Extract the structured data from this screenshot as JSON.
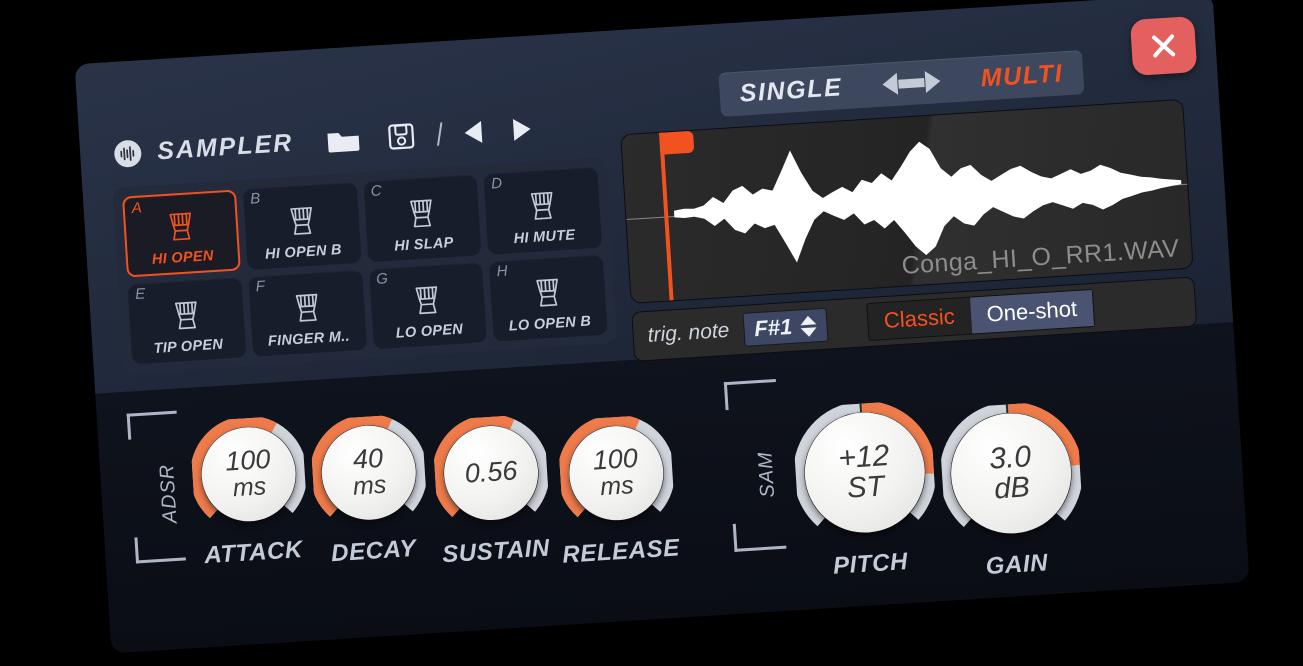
{
  "header": {
    "brand": "SAMPLER",
    "logo_icon": "waveform-circle-icon",
    "open_icon": "folder-icon",
    "save_icon": "floppy-disk-icon",
    "prev_icon": "prev-triangle-icon",
    "next_icon": "next-triangle-icon"
  },
  "mode_toggle": {
    "left_label": "SINGLE",
    "right_label": "MULTI",
    "active": "MULTI",
    "arrows_icon": "left-right-arrows-icon",
    "active_color": "#f2521f",
    "inactive_color": "#e3e7ef"
  },
  "close_button": {
    "icon": "close-x-icon",
    "color": "#e3605f"
  },
  "pads": [
    {
      "letter": "A",
      "label": "HI OPEN",
      "icon": "djembe-icon",
      "selected": true
    },
    {
      "letter": "B",
      "label": "HI OPEN B",
      "icon": "djembe-icon",
      "selected": false
    },
    {
      "letter": "C",
      "label": "HI SLAP",
      "icon": "djembe-icon",
      "selected": false
    },
    {
      "letter": "D",
      "label": "HI MUTE",
      "icon": "djembe-icon",
      "selected": false
    },
    {
      "letter": "E",
      "label": "TIP OPEN",
      "icon": "djembe-icon",
      "selected": false
    },
    {
      "letter": "F",
      "label": "FINGER M..",
      "icon": "djembe-icon",
      "selected": false
    },
    {
      "letter": "G",
      "label": "LO OPEN",
      "icon": "djembe-icon",
      "selected": false
    },
    {
      "letter": "H",
      "label": "LO OPEN B",
      "icon": "djembe-icon",
      "selected": false
    }
  ],
  "waveform": {
    "filename": "Conga_HI_O_RR1.WAV",
    "start_marker_color": "#f2521f",
    "wave_color": "#ffffff"
  },
  "trigger_bar": {
    "note_label": "trig. note",
    "note_value": "F#1",
    "stepper_icon": "up-down-arrows-icon",
    "mode_classic": "Classic",
    "mode_oneshot": "One-shot",
    "active_mode": "One-shot"
  },
  "groups": {
    "adsr_label": "ADSR",
    "sampler_label": "SAM"
  },
  "knobs": [
    {
      "name": "attack",
      "label": "ATTACK",
      "value": "100",
      "unit": "ms",
      "type": "unipolar",
      "amount": 0.62
    },
    {
      "name": "decay",
      "label": "DECAY",
      "value": "40",
      "unit": "ms",
      "type": "unipolar",
      "amount": 0.6
    },
    {
      "name": "sustain",
      "label": "SUSTAIN",
      "value": "0.56",
      "unit": "",
      "type": "unipolar",
      "amount": 0.6
    },
    {
      "name": "release",
      "label": "RELEASE",
      "value": "100",
      "unit": "ms",
      "type": "unipolar",
      "amount": 0.6
    },
    {
      "name": "pitch",
      "label": "PITCH",
      "value": "+12",
      "unit": "ST",
      "type": "bipolar",
      "amount": 0.35
    },
    {
      "name": "gain",
      "label": "GAIN",
      "value": "3.0",
      "unit": "dB",
      "type": "bipolar",
      "amount": 0.32
    }
  ]
}
